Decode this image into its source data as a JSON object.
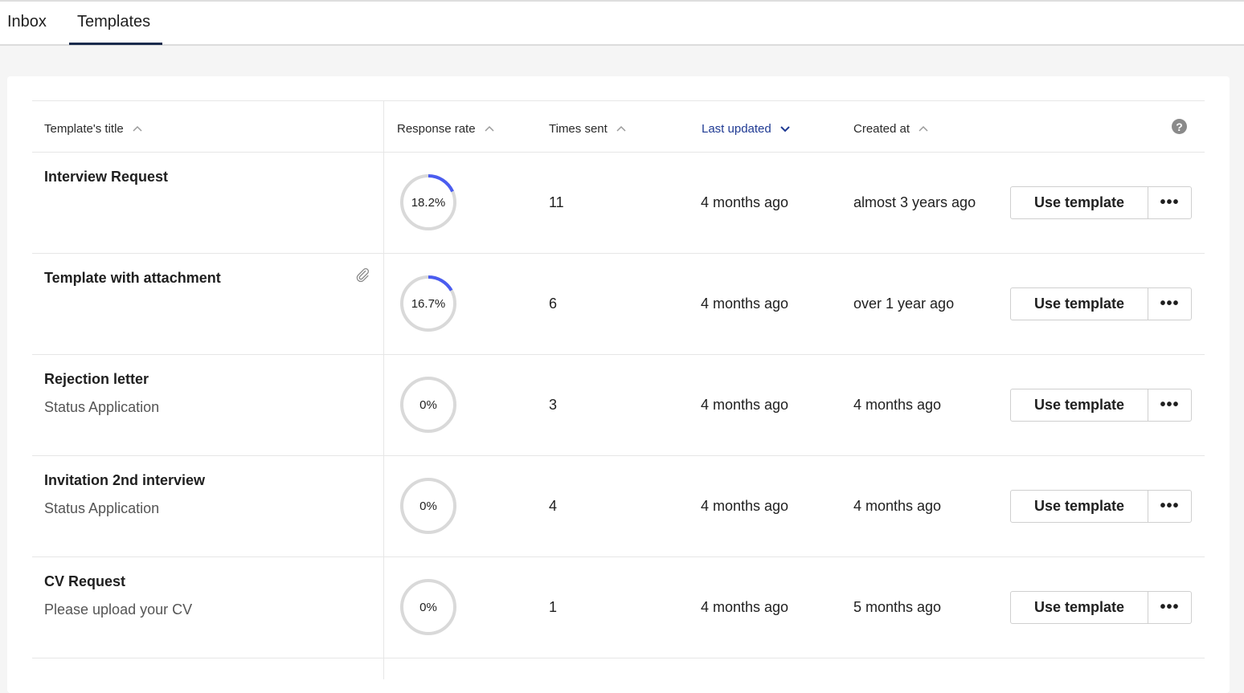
{
  "tabs": {
    "inbox": "Inbox",
    "templates": "Templates"
  },
  "colors": {
    "accent": "#4a5cf0",
    "ring": "#d9d9d9",
    "active_header": "#1f3a93"
  },
  "table": {
    "headers": {
      "title": "Template's title",
      "rate": "Response rate",
      "sent": "Times sent",
      "updated": "Last updated",
      "created": "Created at",
      "help": "?"
    },
    "rows": [
      {
        "title": "Interview Request",
        "subtitle": "",
        "attachment": false,
        "rate_label": "18.2%",
        "rate": 0.182,
        "sent": "11",
        "updated": "4 months ago",
        "created": "almost 3 years ago",
        "use": "Use template",
        "more": "•••"
      },
      {
        "title": "Template with attachment",
        "subtitle": "",
        "attachment": true,
        "rate_label": "16.7%",
        "rate": 0.167,
        "sent": "6",
        "updated": "4 months ago",
        "created": "over 1 year ago",
        "use": "Use template",
        "more": "•••"
      },
      {
        "title": "Rejection letter",
        "subtitle": "Status Application",
        "attachment": false,
        "rate_label": "0%",
        "rate": 0,
        "sent": "3",
        "updated": "4 months ago",
        "created": "4 months ago",
        "use": "Use template",
        "more": "•••"
      },
      {
        "title": "Invitation 2nd interview",
        "subtitle": "Status Application",
        "attachment": false,
        "rate_label": "0%",
        "rate": 0,
        "sent": "4",
        "updated": "4 months ago",
        "created": "4 months ago",
        "use": "Use template",
        "more": "•••"
      },
      {
        "title": "CV Request",
        "subtitle": "Please upload your CV",
        "attachment": false,
        "rate_label": "0%",
        "rate": 0,
        "sent": "1",
        "updated": "4 months ago",
        "created": "5 months ago",
        "use": "Use template",
        "more": "•••"
      }
    ]
  }
}
